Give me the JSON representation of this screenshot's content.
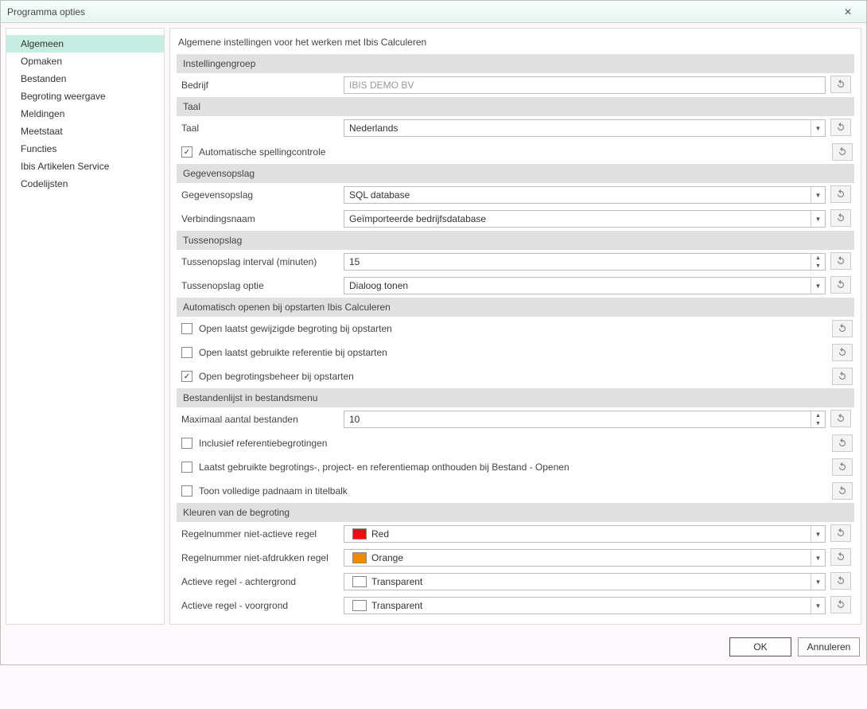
{
  "window": {
    "title": "Programma opties"
  },
  "sidebar": {
    "items": [
      {
        "label": "Algemeen",
        "selected": true
      },
      {
        "label": "Opmaken"
      },
      {
        "label": "Bestanden"
      },
      {
        "label": "Begroting weergave"
      },
      {
        "label": "Meldingen"
      },
      {
        "label": "Meetstaat"
      },
      {
        "label": "Functies"
      },
      {
        "label": "Ibis Artikelen Service"
      },
      {
        "label": "Codelijsten"
      }
    ]
  },
  "intro": "Algemene instellingen voor het werken met Ibis Calculeren",
  "groups": {
    "instellingen": {
      "title": "Instellingengroep",
      "bedrijf_label": "Bedrijf",
      "bedrijf_value": "IBIS DEMO BV"
    },
    "taal": {
      "title": "Taal",
      "taal_label": "Taal",
      "taal_value": "Nederlands",
      "spell_label": "Automatische spellingcontrole",
      "spell_checked": true
    },
    "gegevensopslag": {
      "title": "Gegevensopslag",
      "store_label": "Gegevensopslag",
      "store_value": "SQL database",
      "conn_label": "Verbindingsnaam",
      "conn_value": "Geïmporteerde bedrijfsdatabase"
    },
    "tussenopslag": {
      "title": "Tussenopslag",
      "interval_label": "Tussenopslag interval (minuten)",
      "interval_value": "15",
      "optie_label": "Tussenopslag optie",
      "optie_value": "Dialoog tonen"
    },
    "auto_open": {
      "title": "Automatisch openen bij opstarten Ibis Calculeren",
      "c1_label": "Open laatst gewijzigde begroting bij opstarten",
      "c2_label": "Open laatst gebruikte referentie bij opstarten",
      "c3_label": "Open begrotingsbeheer bij opstarten"
    },
    "bestandenlijst": {
      "title": "Bestandenlijst in bestandsmenu",
      "max_label": "Maximaal aantal bestanden",
      "max_value": "10",
      "c1_label": "Inclusief referentiebegrotingen",
      "c2_label": "Laatst gebruikte begrotings-, project- en referentiemap onthouden bij Bestand - Openen",
      "c3_label": "Toon volledige padnaam in titelbalk"
    },
    "kleuren": {
      "title": "Kleuren van de begroting",
      "r1_label": "Regelnummer niet-actieve regel",
      "r1_value": "Red",
      "r2_label": "Regelnummer niet-afdrukken regel",
      "r2_value": "Orange",
      "r3_label": "Actieve regel - achtergrond",
      "r3_value": "Transparent",
      "r4_label": "Actieve regel - voorgrond",
      "r4_value": "Transparent"
    }
  },
  "footer": {
    "ok": "OK",
    "cancel": "Annuleren"
  }
}
